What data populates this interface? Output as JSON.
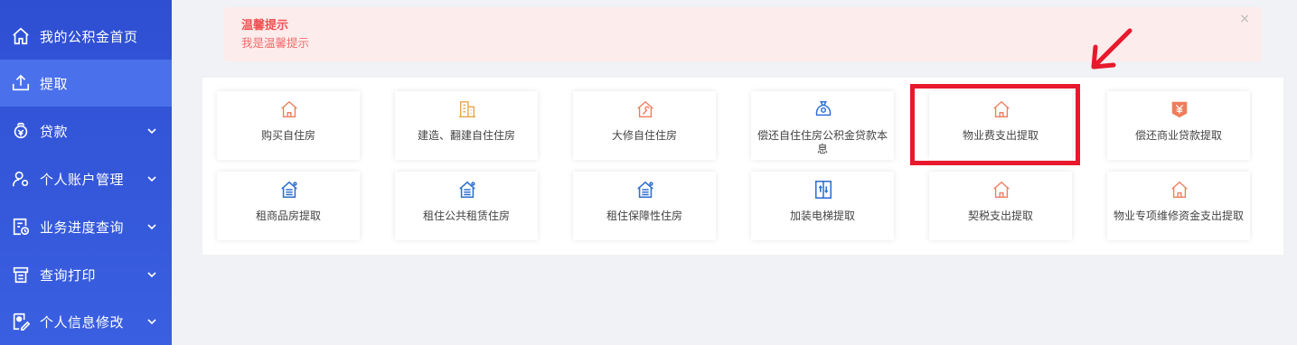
{
  "colors": {
    "sidebar": "#3552d9",
    "sidebar_active": "#4a70ec",
    "alert_text": "#f05252",
    "icon_orange": "#ef7d5c",
    "icon_blue": "#2f6fd1",
    "highlight": "#e8192c"
  },
  "sidebar": {
    "items": [
      {
        "label": "我的公积金首页",
        "icon": "home-icon",
        "expandable": false,
        "active": false
      },
      {
        "label": "提取",
        "icon": "upload-icon",
        "expandable": false,
        "active": true
      },
      {
        "label": "贷款",
        "icon": "loan-icon",
        "expandable": true,
        "active": false
      },
      {
        "label": "个人账户管理",
        "icon": "user-settings-icon",
        "expandable": true,
        "active": false
      },
      {
        "label": "业务进度查询",
        "icon": "progress-icon",
        "expandable": true,
        "active": false
      },
      {
        "label": "查询打印",
        "icon": "print-icon",
        "expandable": true,
        "active": false
      },
      {
        "label": "个人信息修改",
        "icon": "edit-profile-icon",
        "expandable": true,
        "active": false
      }
    ]
  },
  "alert": {
    "title": "温馨提示",
    "text": "我是温馨提示",
    "close": "×"
  },
  "withdraw_options": {
    "row1": [
      {
        "label": "购买自住房",
        "icon": "house-icon"
      },
      {
        "label": "建造、翻建自住住房",
        "icon": "building-icon"
      },
      {
        "label": "大修自住住房",
        "icon": "house-repair-icon"
      },
      {
        "label": "偿还自住住房公积金贷款本息",
        "icon": "money-bag-icon"
      },
      {
        "label": "物业费支出提取",
        "icon": "house-icon"
      },
      {
        "label": "偿还商业贷款提取",
        "icon": "yuan-badge-icon"
      }
    ],
    "row2": [
      {
        "label": "租商品房提取",
        "icon": "rental-house-icon"
      },
      {
        "label": "租住公共租赁住房",
        "icon": "rental-house-icon"
      },
      {
        "label": "租住保障性住房",
        "icon": "rental-house-icon"
      },
      {
        "label": "加装电梯提取",
        "icon": "elevator-icon"
      },
      {
        "label": "契税支出提取",
        "icon": "house-icon"
      },
      {
        "label": "物业专项维修资金支出提取",
        "icon": "house-icon"
      }
    ]
  }
}
